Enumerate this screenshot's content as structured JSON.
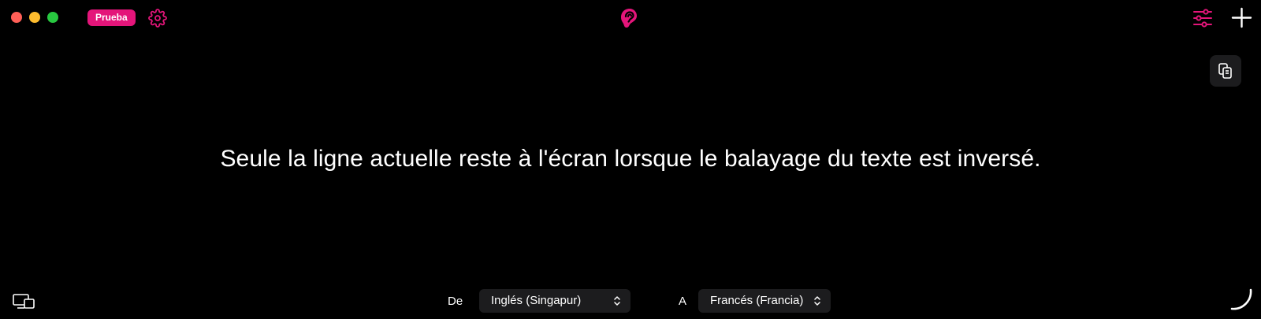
{
  "titlebar": {
    "badge_label": "Prueba",
    "icons": {
      "settings": "gear-icon",
      "logo": "ear-logo-icon",
      "filters": "sliders-icon",
      "add": "plus-icon"
    }
  },
  "toolbar": {
    "copy_icon": "copy-icon"
  },
  "transcript": {
    "text": "Seule la ligne actuelle reste à l'écran lorsque le balayage du texte est inversé."
  },
  "footer": {
    "screen_icon": "display-icon",
    "from_label": "De",
    "from_value": "Inglés (Singapur)",
    "to_label": "A",
    "to_value": "Francés (Francia)"
  },
  "colors": {
    "accent": "#e4157a",
    "background": "#000000",
    "control_bg": "#1c1c1e"
  }
}
